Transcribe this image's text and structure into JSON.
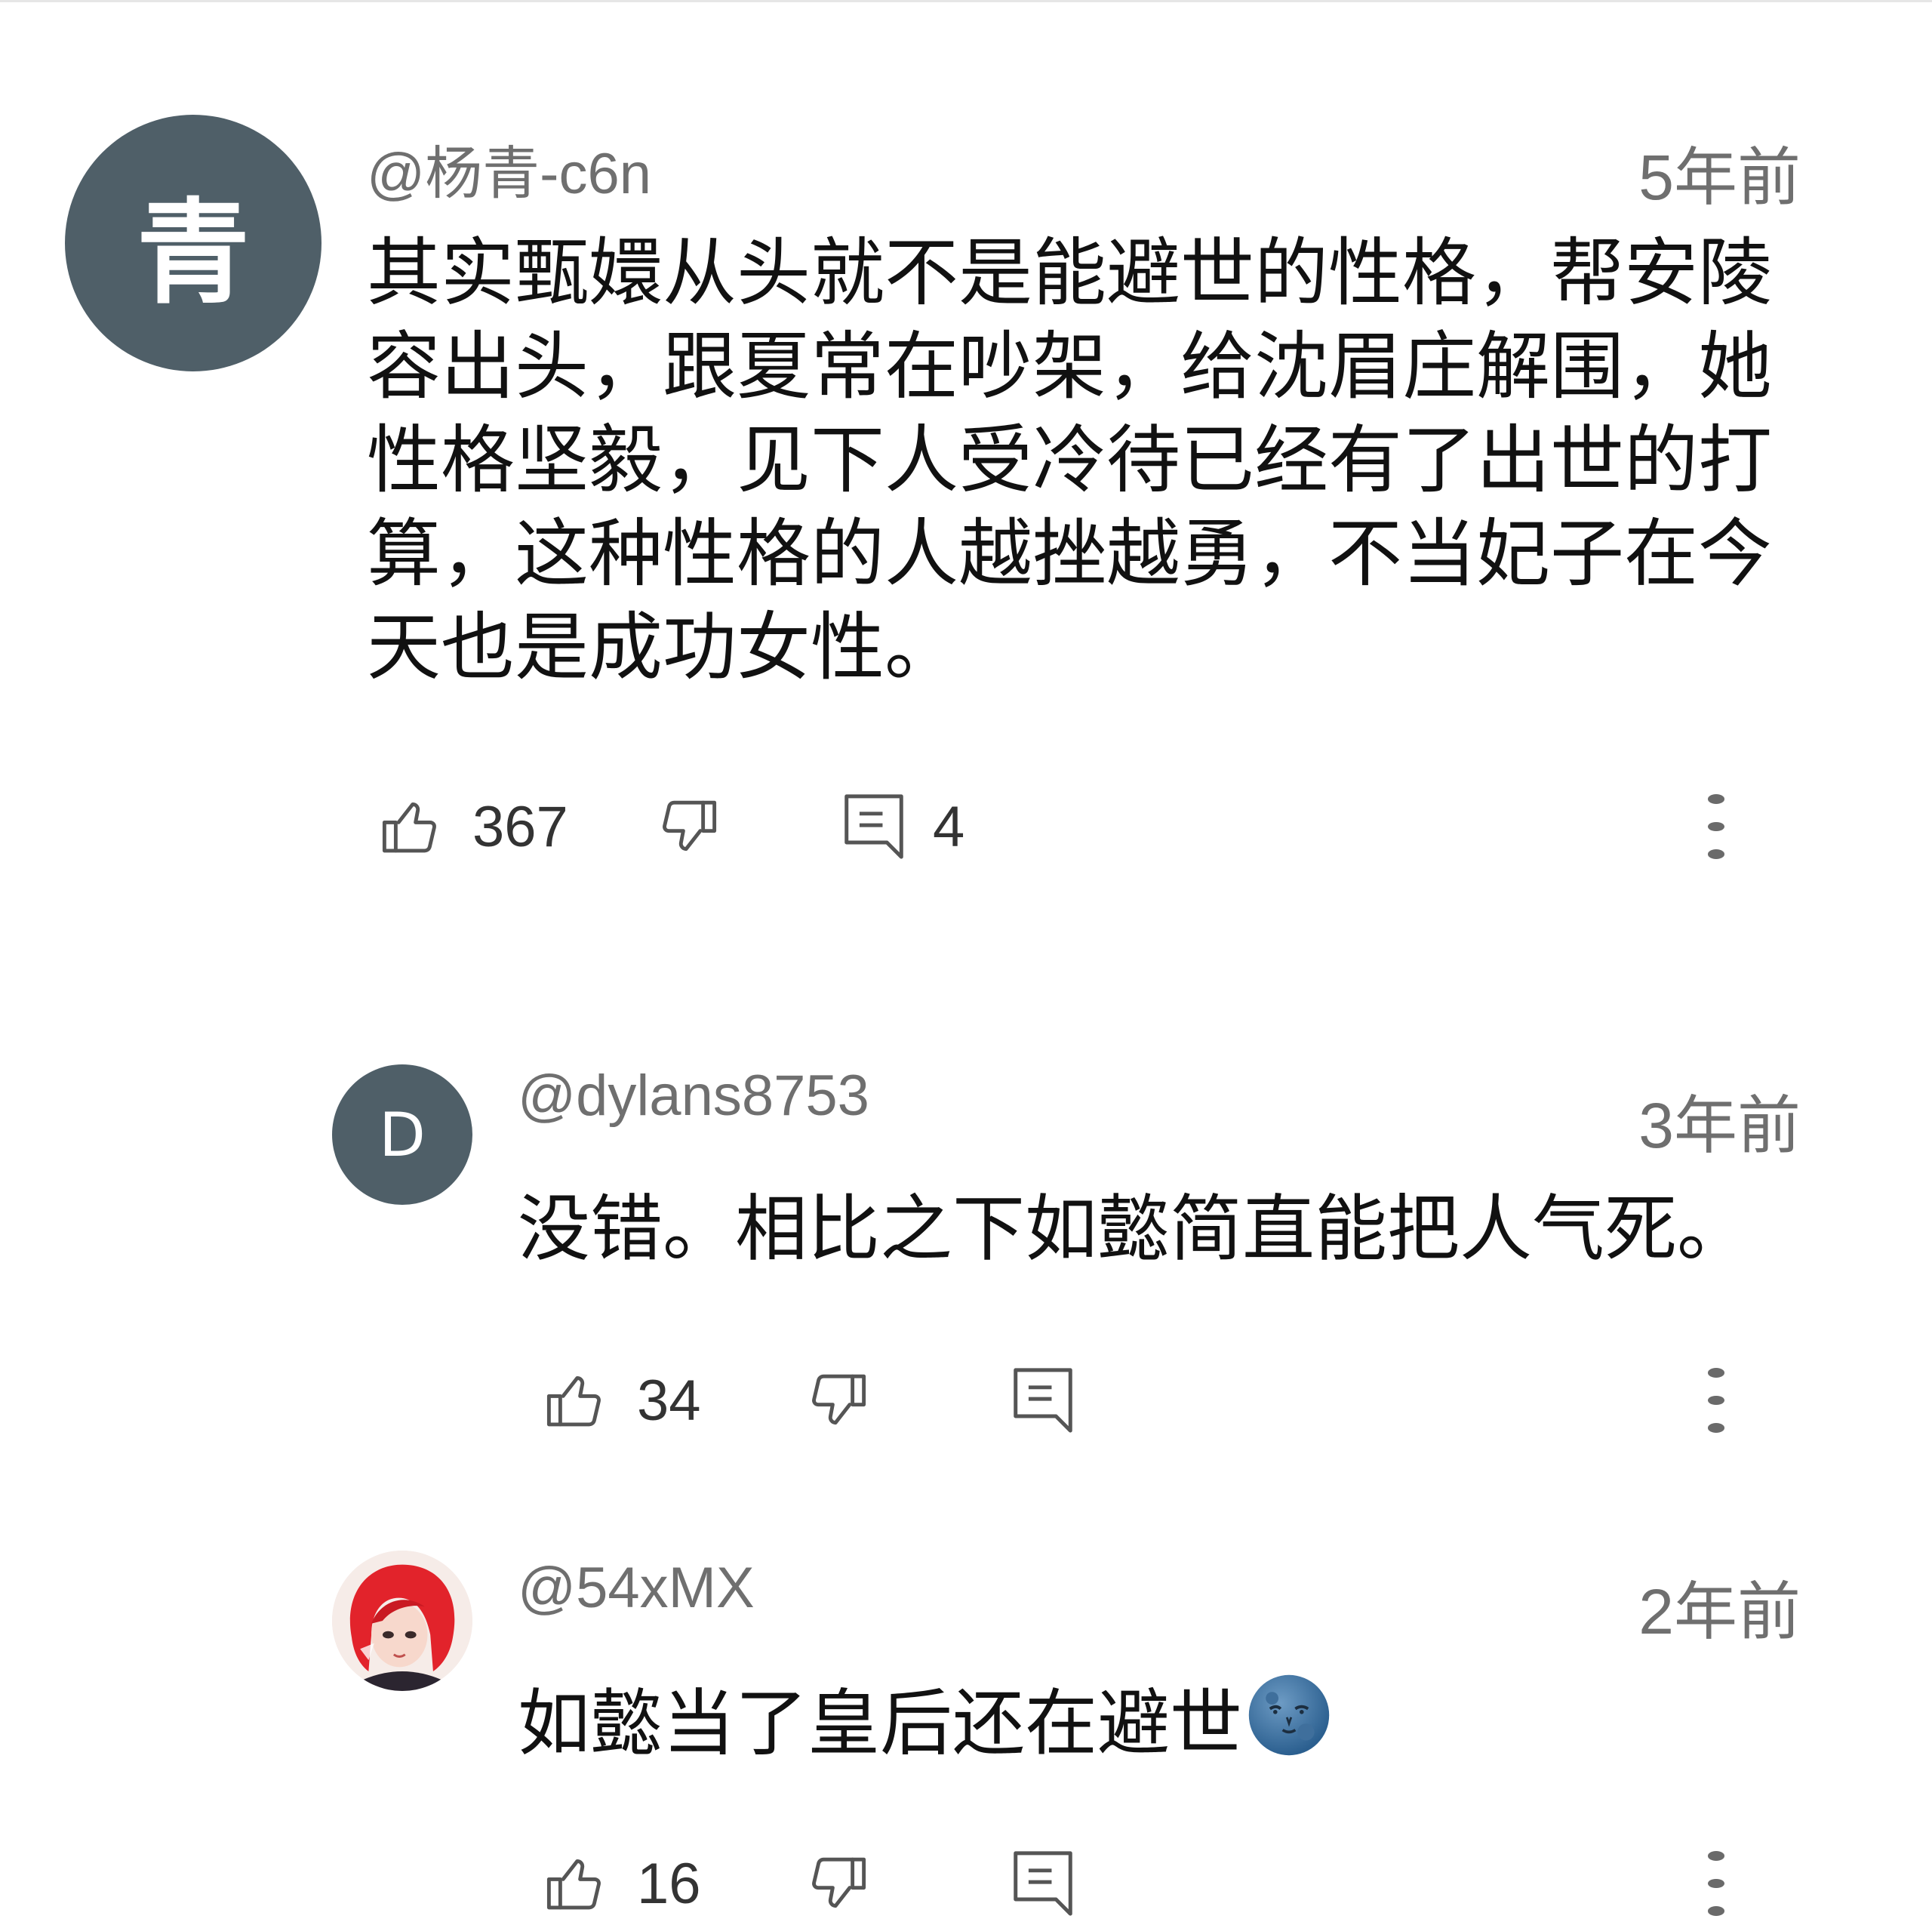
{
  "comments": [
    {
      "avatar_text": "青",
      "avatar_color": "#4f5f68",
      "username": "@杨青-c6n",
      "time": "5年前",
      "text": "其实甄嬛从头就不是能避世的性格，帮安陵容出头，跟夏常在吵架，给沈眉庄解围，她性格坚毅，见下人受冷待已经有了出世的打算，这种性格的人越挫越勇，不当妃子在今天也是成功女性。",
      "likes": "367",
      "replies": "4"
    },
    {
      "avatar_text": "D",
      "avatar_color": "#4f5f68",
      "username": "@dylans8753",
      "time": "3年前",
      "text": "没错。相比之下如懿简直能把人气死。",
      "likes": "34"
    },
    {
      "avatar_image": "red-haired-girl-avatar",
      "username": "@54xMX",
      "time": "2年前",
      "text": "如懿当了皇后还在避世",
      "emoji": "new-moon-face-emoji",
      "likes": "16"
    }
  ],
  "icons": {
    "like": "thumbs-up-icon",
    "dislike": "thumbs-down-icon",
    "reply": "reply-comment-icon",
    "more": "more-vertical-icon"
  }
}
